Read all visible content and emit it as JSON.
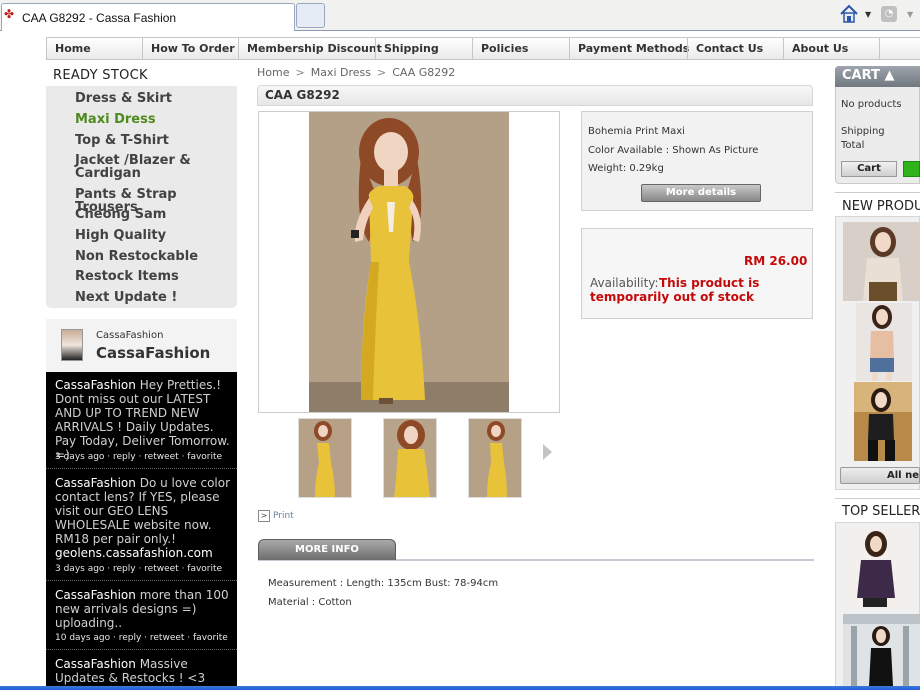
{
  "browser": {
    "tab_title": "CAA G8292 - Cassa Fashion",
    "home_icon": "home-icon",
    "rss_icon": "rss-icon"
  },
  "nav": {
    "items": [
      "Home",
      "How To Order",
      "Membership Discount",
      "Shipping",
      "Policies",
      "Payment Methods",
      "Contact Us",
      "About Us"
    ]
  },
  "sidebar": {
    "title": "READY STOCK",
    "categories": [
      "Dress & Skirt",
      "Maxi Dress",
      "Top & T-Shirt",
      "Jacket /Blazer & Cardigan",
      "Pants & Strap Trousers",
      "Cheong Sam",
      "High Quality",
      "Non Restockable",
      "Restock Items",
      "Next Update !"
    ],
    "active_category": "Maxi Dress"
  },
  "twitter": {
    "handle": "CassaFashion",
    "name": "CassaFashion",
    "tweets": [
      {
        "user": "CassaFashion",
        "text": " Hey Pretties.! Dont miss out our LATEST AND UP TO TREND NEW ARRIVALS ! Daily Updates. Pay Today, Deliver Tomorrow. =)",
        "link": "",
        "meta": "3 days ago · reply · retweet · favorite"
      },
      {
        "user": "CassaFashion",
        "text": " Do u love color contact lens? If YES, please visit our GEO LENS WHOLESALE website now. RM18 per pair only.!",
        "link": "geolens.cassafashion.com",
        "meta": "3 days ago · reply · retweet · favorite"
      },
      {
        "user": "CassaFashion",
        "text": " more than 100 new arrivals designs =) uploading..",
        "link": "",
        "meta": "10 days ago · reply · retweet · favorite"
      },
      {
        "user": "CassaFashion",
        "text": " Massive Updates & Restocks ! <3",
        "link": "",
        "meta": ""
      }
    ]
  },
  "breadcrumb": {
    "items": [
      "Home",
      "Maxi Dress",
      "CAA G8292"
    ],
    "separator": ">"
  },
  "product": {
    "title": "CAA G8292",
    "name": "Bohemia Print Maxi",
    "color": "Color Available : Shown As Picture",
    "weight": "Weight: 0.29kg",
    "more_details_label": "More details",
    "price": "RM 26.00",
    "availability_label": "Availability:",
    "availability_value": "This product is temporarily out of stock",
    "print_label": "Print",
    "more_info_tab": "MORE INFO",
    "measurement": "Measurement : Length: 135cm Bust: 78-94cm",
    "material": "Material : Cotton",
    "dress_color": "#e8c33a",
    "price_color": "#c50a0a"
  },
  "cart": {
    "title": "CART",
    "empty_text": "No products",
    "shipping_label": "Shipping",
    "total_label": "Total",
    "cart_button": "Cart"
  },
  "new_products": {
    "title": "NEW PRODUCTS",
    "all_button": "All new products"
  },
  "top_sellers": {
    "title": "TOP SELLERS"
  },
  "colors": {
    "accent_green": "#4f8a1e",
    "checkout_green": "#2fb21b"
  }
}
